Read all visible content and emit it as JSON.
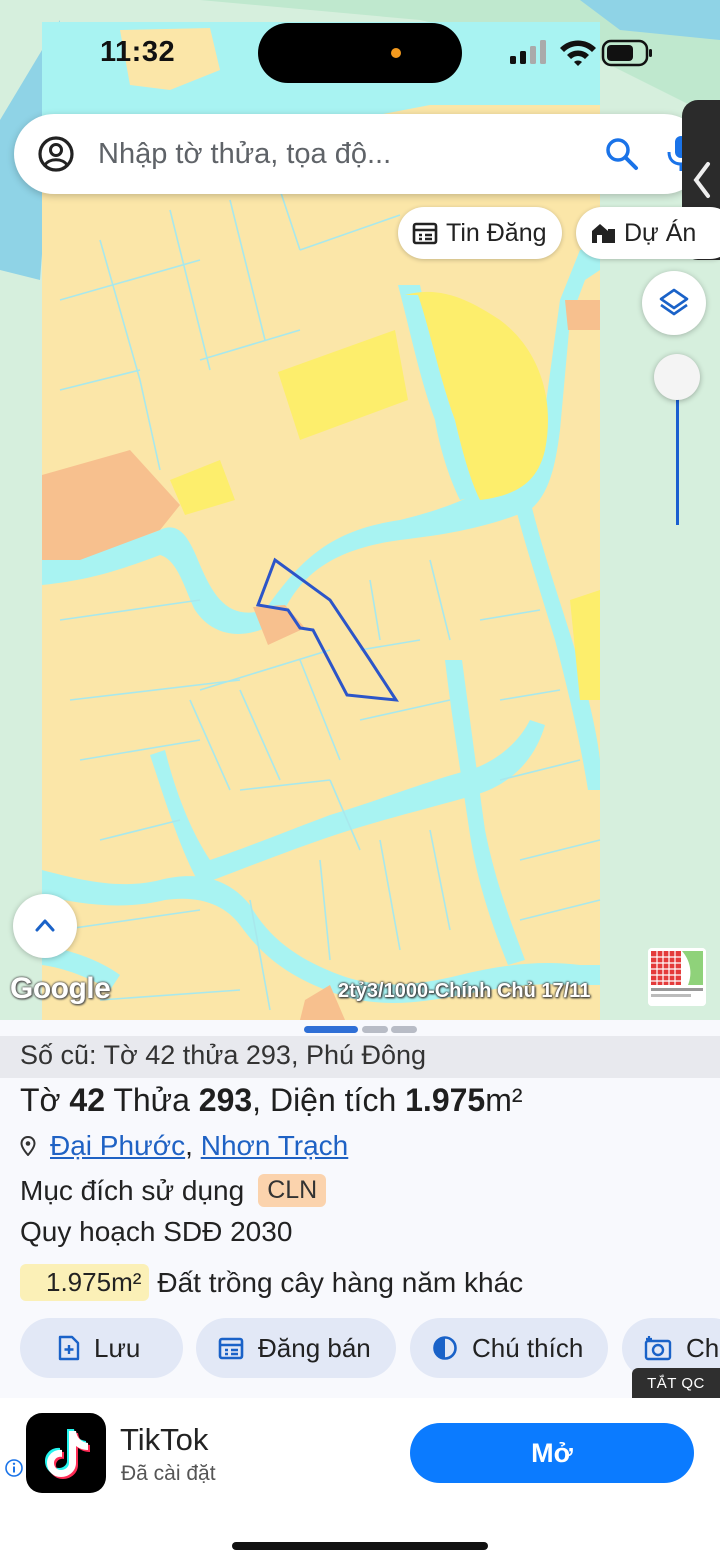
{
  "status": {
    "time": "11:32"
  },
  "search": {
    "placeholder": "Nhập tờ thửa, tọa độ..."
  },
  "chips": {
    "listings": "Tin Đăng",
    "projects": "Dự Án"
  },
  "map": {
    "attribution": "Google",
    "caption": "2tỷ3/1000-Chính Chủ 17/11"
  },
  "parcel": {
    "old_info": "Số cũ: Tờ 42 thửa 293, Phú Đông",
    "sheet_label": "Tờ",
    "sheet_no": "42",
    "plot_label": "Thửa",
    "plot_no": "293",
    "area_label": ", Diện tích",
    "area_value": "1.975",
    "area_unit": "m²",
    "ward": "Đại Phước",
    "district": "Nhơn Trạch",
    "purpose_label": "Mục đích sử dụng",
    "purpose_code": "CLN",
    "plan_label": "Quy hoạch SDĐ 2030",
    "plan_area": "1.975m²",
    "plan_use": "Đất trồng cây hàng năm khác"
  },
  "actions": {
    "save": "Lưu",
    "post_sale": "Đăng bán",
    "legend": "Chú thích",
    "capture": "Ch"
  },
  "ad": {
    "label": "TẮT QC",
    "app_name": "TikTok",
    "app_status": "Đã cài đặt",
    "open_button": "Mở"
  },
  "colors": {
    "land": "#fbe6a8",
    "water": "#a8f3f2",
    "yellow_zone": "#fdee6c",
    "orange_zone": "#f7c08e",
    "parcel_outline": "#2c55c8",
    "accent_blue": "#1f62c4",
    "open_button": "#0b7bff"
  }
}
